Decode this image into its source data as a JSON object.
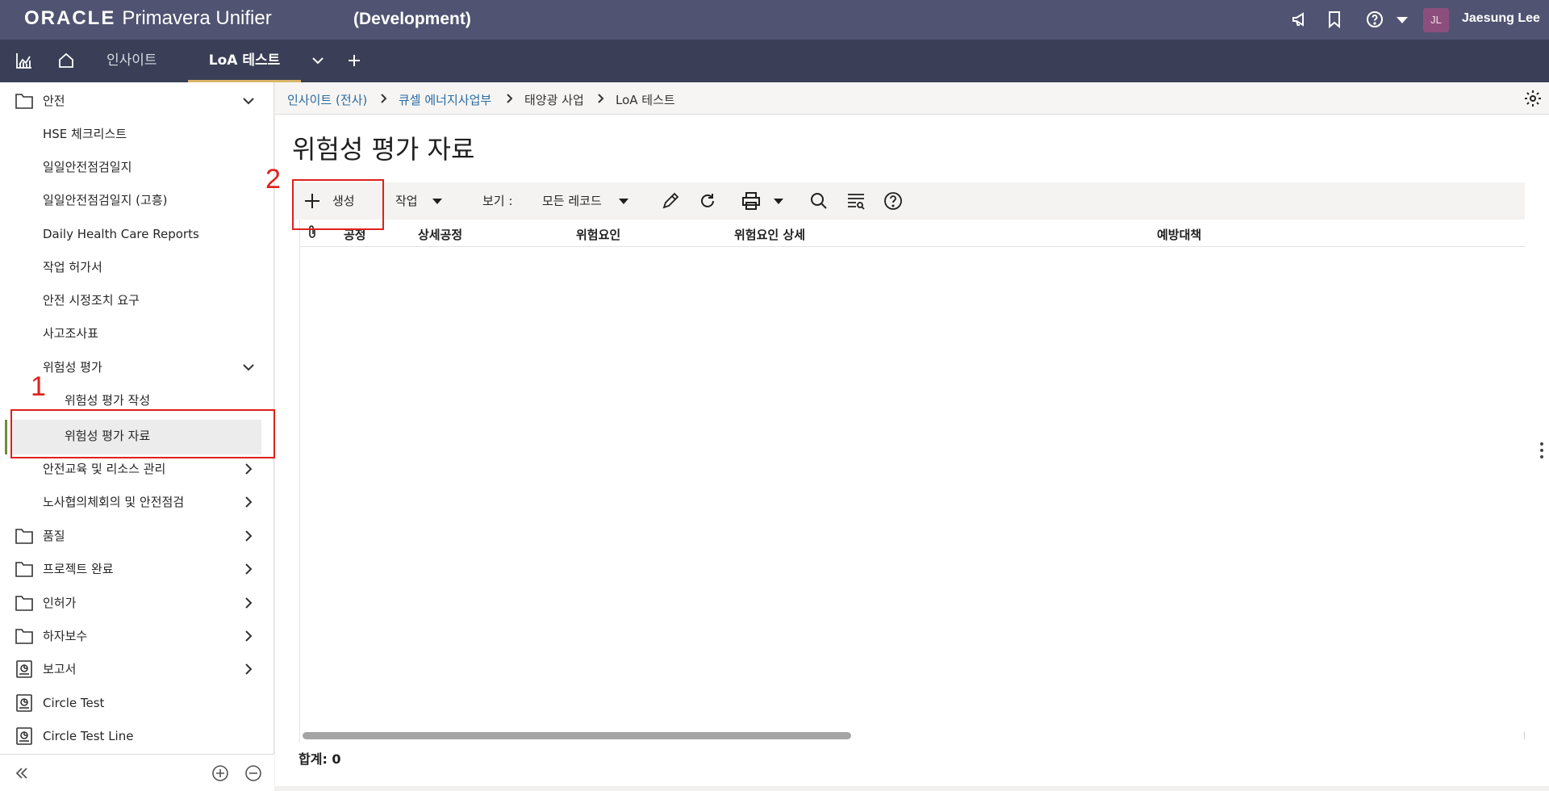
{
  "header": {
    "brand": "ORACLE",
    "product": "Primavera Unifier",
    "environment": "(Development)",
    "user_initials": "JL",
    "user_name": "Jaesung Lee",
    "icons": [
      "megaphone-icon",
      "bookmark-icon",
      "help-icon",
      "chevron-down-icon"
    ]
  },
  "tabs": {
    "icons": [
      "dashboard-icon",
      "home-icon",
      "chevron-down-icon",
      "add-icon"
    ],
    "items": [
      {
        "label": "인사이트",
        "active": false
      },
      {
        "label": "LoA 테스트",
        "active": true
      }
    ]
  },
  "sidebar": {
    "items": [
      {
        "label": "안전",
        "type": "folder",
        "expanded": true
      },
      {
        "label": "HSE 체크리스트",
        "type": "node"
      },
      {
        "label": "일일안전점검일지",
        "type": "node"
      },
      {
        "label": "일일안전점검일지 (고흥)",
        "type": "node"
      },
      {
        "label": "Daily Health Care Reports",
        "type": "node"
      },
      {
        "label": "작업 허가서",
        "type": "node"
      },
      {
        "label": "안전 시정조치 요구",
        "type": "node"
      },
      {
        "label": "사고조사표",
        "type": "node"
      },
      {
        "label": "위험성 평가",
        "type": "node",
        "expanded": true
      },
      {
        "label": "위험성 평가 작성",
        "type": "leaf"
      },
      {
        "label": "위험성 평가 자료",
        "type": "leaf",
        "selected": true
      },
      {
        "label": "안전교육 및 리소스 관리",
        "type": "node"
      },
      {
        "label": "노사협의체회의 및 안전점검",
        "type": "node"
      },
      {
        "label": "품질",
        "type": "folder"
      },
      {
        "label": "프로젝트 완료",
        "type": "folder"
      },
      {
        "label": "인허가",
        "type": "folder"
      },
      {
        "label": "하자보수",
        "type": "folder"
      },
      {
        "label": "보고서",
        "type": "report-folder"
      },
      {
        "label": "Circle Test",
        "type": "report"
      },
      {
        "label": "Circle Test Line",
        "type": "report"
      }
    ]
  },
  "annotations": {
    "step1": "1",
    "step2": "2"
  },
  "breadcrumb": [
    {
      "label": "인사이트 (전사)",
      "link": true
    },
    {
      "label": "큐셀 에너지사업부",
      "link": true
    },
    {
      "label": "태양광 사업",
      "link": false
    },
    {
      "label": "LoA 테스트",
      "link": false
    }
  ],
  "page": {
    "title": "위험성 평가 자료"
  },
  "toolbar": {
    "create_label": "생성",
    "action_label": "작업",
    "view_label": "보기 :",
    "view_value": "모든 레코드"
  },
  "grid": {
    "columns": [
      "공정",
      "상세공정",
      "위험요인",
      "위험요인 상세",
      "예방대책"
    ],
    "rows": []
  },
  "footer": {
    "total": "합계: 0"
  },
  "colors": {
    "header_bg": "#505472",
    "tab_bg": "#3a3f57",
    "active_tab_underline": "#d9b569",
    "annotation_red": "#e0201b",
    "link": "#2a6ba3"
  }
}
